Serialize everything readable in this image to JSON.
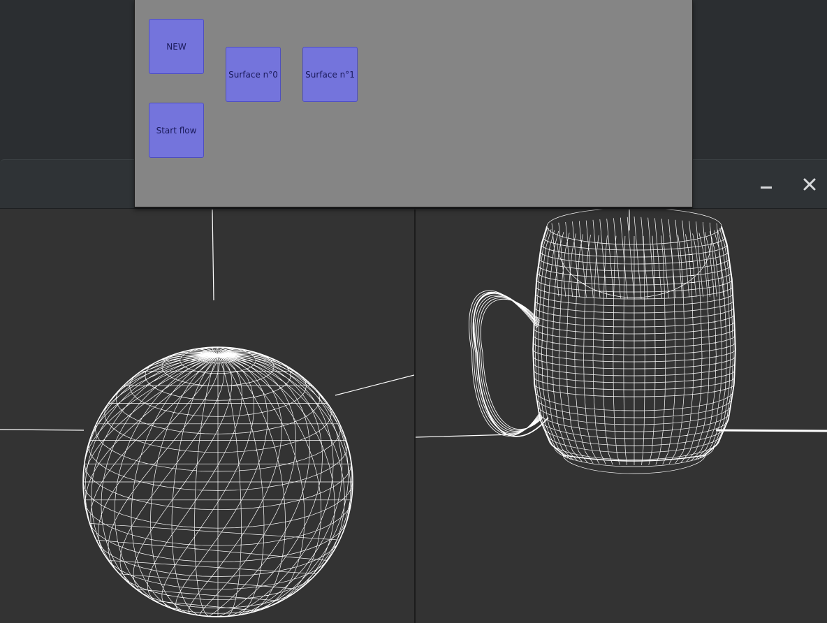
{
  "panel": {
    "buttons": {
      "new_label": "NEW",
      "start_flow_label": "Start flow",
      "surface0_label": "Surface n°0",
      "surface1_label": "Surface n°1"
    }
  },
  "window": {
    "close_icon": "close-icon",
    "minimize_icon": "minimize-icon"
  },
  "viewports": {
    "left": {
      "object": "sphere-wireframe",
      "render_mode": "wireframe"
    },
    "right": {
      "object": "mug-wireframe",
      "render_mode": "wireframe"
    }
  },
  "colors": {
    "viewport_bg": "#333333",
    "wireframe": "#ffffff",
    "panel_bg": "#858585",
    "button_bg": "#7474dc",
    "button_text": "#1a1a5a"
  }
}
